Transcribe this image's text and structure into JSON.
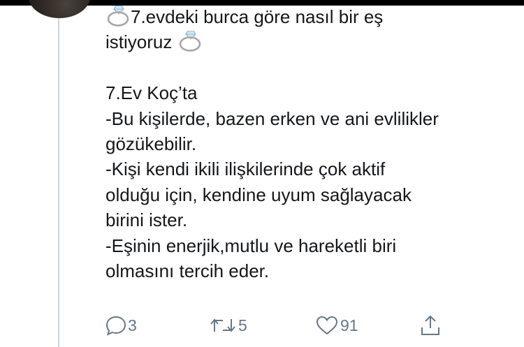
{
  "tweet": {
    "lines": [
      "7.evdeki burca göre nasıl bir eş",
      "istiyoruz",
      "",
      "7.Ev Koç’ta",
      "-Bu kişilerde, bazen erken ve ani evlilikler",
      "gözükebilir.",
      "-Kişi kendi ikili ilişkilerinde çok aktif",
      "olduğu için, kendine uyum sağlayacak",
      "birini ister.",
      "-Eşinin enerjik,mutlu ve hareketli biri",
      "olmasını tercih eder."
    ],
    "emoji_icon": "ring-icon"
  },
  "actions": {
    "reply_count": "3",
    "retweet_count": "5",
    "like_count": "91"
  },
  "colors": {
    "text": "#14171a",
    "action_gray": "#657786",
    "thread_line": "#ccd6dd",
    "top_strip": "#000000"
  }
}
